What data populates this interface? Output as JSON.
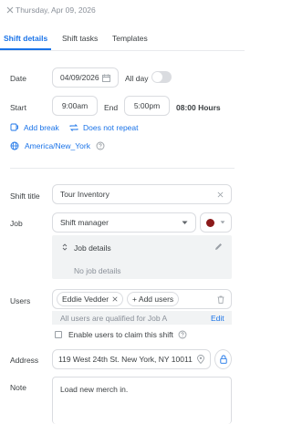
{
  "header": {
    "date": "Thursday, Apr 09, 2026"
  },
  "tabs": [
    {
      "label": "Shift details",
      "active": true
    },
    {
      "label": "Shift tasks",
      "active": false
    },
    {
      "label": "Templates",
      "active": false
    }
  ],
  "date_row": {
    "label": "Date",
    "value": "04/09/2026",
    "allday_label": "All day",
    "allday_on": false
  },
  "time_row": {
    "start_label": "Start",
    "start_value": "9:00am",
    "end_label": "End",
    "end_value": "5:00pm",
    "hours": "08:00 Hours"
  },
  "links": {
    "add_break": "Add break",
    "repeat": "Does not repeat",
    "timezone": "America/New_York"
  },
  "shift_title": {
    "label": "Shift title",
    "value": "Tour Inventory"
  },
  "job": {
    "label": "Job",
    "value": "Shift manager",
    "color": "#8b1a1a",
    "details_label": "Job details",
    "no_details": "No job details"
  },
  "users": {
    "label": "Users",
    "chip": "Eddie Vedder",
    "add_label": "+ Add users",
    "qualified_text": "All users are qualified for Job A",
    "edit_label": "Edit",
    "claim_label": "Enable users to claim this shift"
  },
  "address": {
    "label": "Address",
    "value": "119 West 24th St. New York, NY 10011"
  },
  "note": {
    "label": "Note",
    "value": "Load new merch in."
  },
  "colors": {
    "accent": "#1a73e8",
    "panel": "#f1f3f4",
    "border": "#dadce0"
  }
}
